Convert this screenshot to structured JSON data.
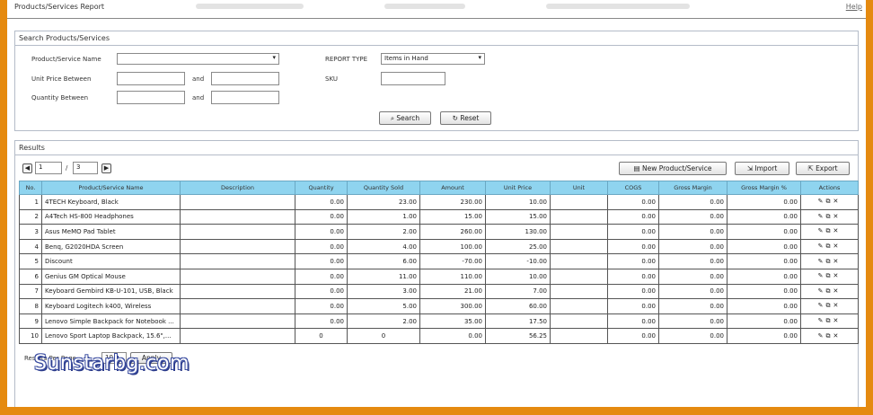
{
  "header": {
    "title": "Products/Services Report",
    "help_link": "Help"
  },
  "search": {
    "title": "Search Products/Services",
    "product_label": "Product/Service Name",
    "product_value": "",
    "unit_price_label": "Unit Price Between",
    "and_label": "and",
    "quantity_label": "Quantity Between",
    "report_type_label": "REPORT TYPE",
    "report_type_value": "Items in Hand",
    "sku_label": "SKU",
    "search_button": "Search",
    "reset_button": "Reset"
  },
  "results": {
    "title": "Results",
    "page_current": "1",
    "page_sep": "/",
    "page_total": "3",
    "new_button": "New Product/Service",
    "import_button": "Import",
    "export_button": "Export",
    "columns": [
      "No.",
      "Product/Service Name",
      "Description",
      "Quantity",
      "Quantity Sold",
      "Amount",
      "Unit Price",
      "Unit",
      "COGS",
      "Gross Margin",
      "Gross Margin %",
      "Actions"
    ],
    "rows": [
      {
        "no": "1",
        "name": "4TECH Keyboard, Black",
        "desc": "",
        "qty": "0.00",
        "sold": "23.00",
        "amount": "230.00",
        "price": "10.00",
        "unit": "",
        "cogs": "0.00",
        "gm": "0.00",
        "gmp": "0.00"
      },
      {
        "no": "2",
        "name": "A4Tech HS-800 Headphones",
        "desc": "",
        "qty": "0.00",
        "sold": "1.00",
        "amount": "15.00",
        "price": "15.00",
        "unit": "",
        "cogs": "0.00",
        "gm": "0.00",
        "gmp": "0.00"
      },
      {
        "no": "3",
        "name": "Asus MeMO Pad Tablet",
        "desc": "",
        "qty": "0.00",
        "sold": "2.00",
        "amount": "260.00",
        "price": "130.00",
        "unit": "",
        "cogs": "0.00",
        "gm": "0.00",
        "gmp": "0.00"
      },
      {
        "no": "4",
        "name": "Benq, G2020HDA Screen",
        "desc": "",
        "qty": "0.00",
        "sold": "4.00",
        "amount": "100.00",
        "price": "25.00",
        "unit": "",
        "cogs": "0.00",
        "gm": "0.00",
        "gmp": "0.00"
      },
      {
        "no": "5",
        "name": "Discount",
        "desc": "",
        "qty": "0.00",
        "sold": "6.00",
        "amount": "-70.00",
        "price": "-10.00",
        "unit": "",
        "cogs": "0.00",
        "gm": "0.00",
        "gmp": "0.00"
      },
      {
        "no": "6",
        "name": "Genius GM Optical Mouse",
        "desc": "",
        "qty": "0.00",
        "sold": "11.00",
        "amount": "110.00",
        "price": "10.00",
        "unit": "",
        "cogs": "0.00",
        "gm": "0.00",
        "gmp": "0.00"
      },
      {
        "no": "7",
        "name": "Keyboard Gembird KB-U-101, USB, Black",
        "desc": "",
        "qty": "0.00",
        "sold": "3.00",
        "amount": "21.00",
        "price": "7.00",
        "unit": "",
        "cogs": "0.00",
        "gm": "0.00",
        "gmp": "0.00"
      },
      {
        "no": "8",
        "name": "Keyboard Logitech k400, Wireless",
        "desc": "",
        "qty": "0.00",
        "sold": "5.00",
        "amount": "300.00",
        "price": "60.00",
        "unit": "",
        "cogs": "0.00",
        "gm": "0.00",
        "gmp": "0.00"
      },
      {
        "no": "9",
        "name": "Lenovo Simple Backpack for Notebook ...",
        "desc": "",
        "qty": "0.00",
        "sold": "2.00",
        "amount": "35.00",
        "price": "17.50",
        "unit": "",
        "cogs": "0.00",
        "gm": "0.00",
        "gmp": "0.00"
      },
      {
        "no": "10",
        "name": "Lenovo Sport Laptop Backpack, 15.6\",...",
        "desc": "",
        "qty": "0",
        "sold": "0",
        "amount": "0.00",
        "price": "56.25",
        "unit": "",
        "cogs": "0.00",
        "gm": "0.00",
        "gmp": "0.00"
      }
    ],
    "results_per_page_label": "Results Per Page",
    "results_per_page_value": "10",
    "apply_button": "Apply"
  },
  "watermark": "Sunstarbg.com",
  "icons": {
    "search": "search-icon",
    "reset": "reset-icon",
    "new": "new-icon",
    "import": "import-icon",
    "export": "export-icon",
    "edit": "edit-icon",
    "copy": "copy-icon",
    "delete": "delete-icon",
    "prev": "prev-page-icon",
    "next": "next-page-icon"
  }
}
